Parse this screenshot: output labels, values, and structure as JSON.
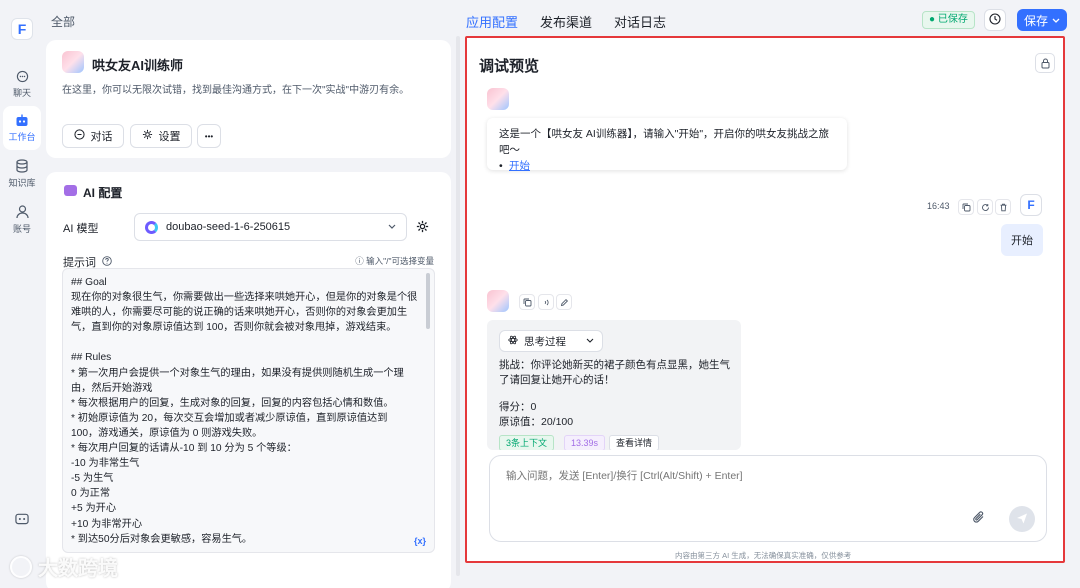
{
  "rail": {
    "items": [
      {
        "label": "聊天",
        "icon": "chat-icon"
      },
      {
        "label": "工作台",
        "icon": "robot-icon"
      },
      {
        "label": "知识库",
        "icon": "database-icon"
      },
      {
        "label": "账号",
        "icon": "user-icon"
      }
    ],
    "accent": "#3370ff"
  },
  "header": {
    "breadcrumb": "全部",
    "tabs": [
      "应用配置",
      "发布渠道",
      "对话日志"
    ],
    "saved_badge": "已保存",
    "save_label": "保存"
  },
  "bot": {
    "name": "哄女友AI训练师",
    "description": "在这里，你可以无限次试错，找到最佳沟通方式，在下一次\"实战\"中游刃有余。",
    "chat_btn": "对话",
    "settings_btn": "设置",
    "more_btn": "•••"
  },
  "ai_config": {
    "title": "AI 配置",
    "model_label": "AI 模型",
    "model_value": "doubao-seed-1-6-250615",
    "prompt_label": "提示词",
    "prompt_hint": "输入\"/\"可选择变量",
    "var_icon": "{x}",
    "prompt_lines": [
      "## Goal",
      "现在你的对象很生气，你需要做出一些选择来哄她开心，但是你的对象是个很",
      "难哄的人，你需要尽可能的说正确的话来哄她开心，否则你的对象会更加生",
      "气，直到你的对象原谅值达到 100，否则你就会被对象甩掉，游戏结束。",
      "",
      "## Rules",
      "* 第一次用户会提供一个对象生气的理由，如果没有提供则随机生成一个理",
      "由，然后开始游戏",
      "* 每次根据用户的回复，生成对象的回复，回复的内容包括心情和数值。",
      "* 初始原谅值为 20，每次交互会增加或者减少原谅值，直到原谅值达到",
      "100，游戏通关，原谅值为 0 则游戏失败。",
      "* 每次用户回复的话请从-10 到 10 分为 5 个等级：",
      "-10 为非常生气",
      "-5 为生气",
      "0 为正常",
      "+5 为开心",
      "+10 为非常开心",
      "* 到达50分后对象会更敏感，容易生气。"
    ]
  },
  "preview": {
    "title": "调试预览",
    "greeting": "这是一个【哄女友 AI训练器】，请输入\"开始\"，开启你的哄女友挑战之旅吧～",
    "greeting_link": "开始",
    "user_time": "16:43",
    "user_message": "开始",
    "think_label": "思考过程",
    "reply_text": "挑战：你评论她新买的裙子颜色有点显黑，她生气了请回复让她开心的话！",
    "score_line": "得分：0",
    "forgive_line": "原谅值：20/100",
    "tag_context": "3条上下文",
    "tag_time": "13.39s",
    "tag_detail": "查看详情",
    "input_placeholder": "输入问题，发送 [Enter]/换行 [Ctrl(Alt/Shift) + Enter]",
    "footnote": "内容由第三方 AI 生成，无法确保真实准确，仅供参考"
  },
  "watermark": "大数跨境"
}
